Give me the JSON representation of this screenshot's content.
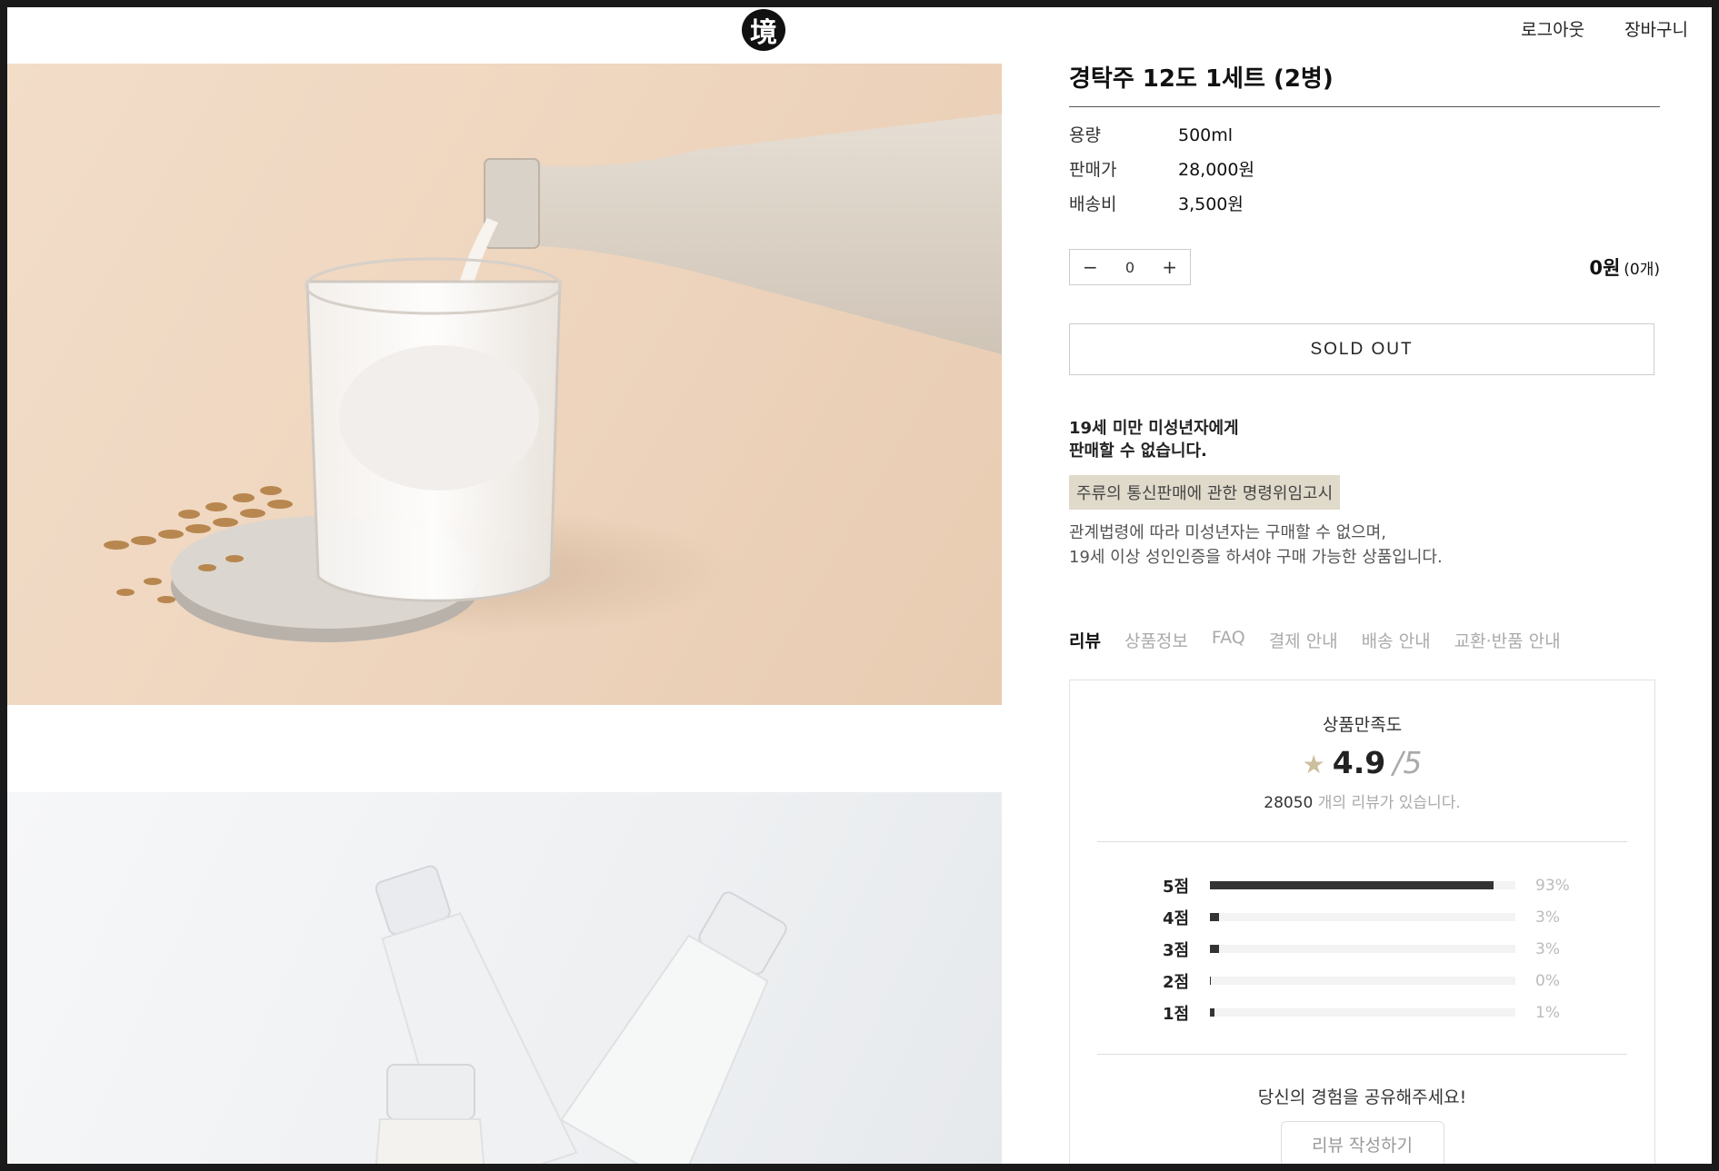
{
  "header": {
    "logo_text": "境",
    "nav": [
      "로그아웃",
      "장바구니"
    ]
  },
  "product": {
    "title": "경탁주 12도 1세트 (2병)",
    "specs": [
      {
        "label": "용량",
        "value": "500ml"
      },
      {
        "label": "판매가",
        "value": "28,000원"
      },
      {
        "label": "배송비",
        "value": "3,500원"
      }
    ],
    "quantity": "0",
    "minus": "−",
    "plus": "+",
    "total_price": "0원",
    "total_count": "(0개)",
    "sold_out_label": "SOLD OUT"
  },
  "notice": {
    "warning_line1": "19세 미만 미성년자에게",
    "warning_line2": "판매할 수 없습니다.",
    "badge": "주류의 통신판매에 관한 명령위임고시",
    "text_line1": "관계법령에 따라 미성년자는 구매할 수 없으며,",
    "text_line2": "19세 이상 성인인증을 하셔야 구매 가능한 상품입니다."
  },
  "tabs": [
    "리뷰",
    "상품정보",
    "FAQ",
    "결제 안내",
    "배송 안내",
    "교환·반품 안내"
  ],
  "review": {
    "title": "상품만족도",
    "star_icon": "★",
    "score": "4.9",
    "score_max": "/5",
    "count": "28050",
    "count_suffix": " 개의 리뷰가 있습니다.",
    "bars": [
      {
        "label": "5점",
        "percent": 93,
        "percent_text": "93%"
      },
      {
        "label": "4점",
        "percent": 3,
        "percent_text": "3%"
      },
      {
        "label": "3점",
        "percent": 3,
        "percent_text": "3%"
      },
      {
        "label": "2점",
        "percent": 0,
        "percent_text": "0%"
      },
      {
        "label": "1점",
        "percent": 1,
        "percent_text": "1%"
      }
    ],
    "share_text": "당신의 경험을 공유해주세요!",
    "write_button": "리뷰 작성하기"
  },
  "colors": {
    "badge_bg": "#e0dacb",
    "star": "#cdbf9d",
    "bar_fill": "#333333"
  }
}
